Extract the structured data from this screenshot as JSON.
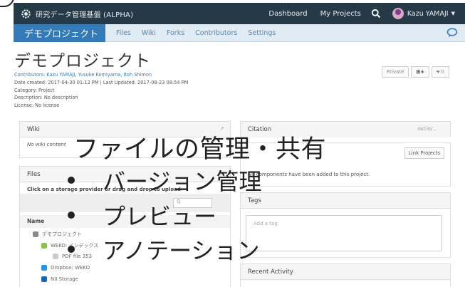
{
  "header": {
    "brand": "研究データ管理基盤 (ALPHA)",
    "nav": [
      "Dashboard",
      "My Projects"
    ],
    "user": "Kazu YAMAJI"
  },
  "project_bar": {
    "title": "デモプロジェクト",
    "tabs": [
      "Files",
      "Wiki",
      "Forks",
      "Contributors",
      "Settings"
    ]
  },
  "page": {
    "title": "デモプロジェクト",
    "badges": {
      "privacy": "Private",
      "fork_count": "0"
    },
    "meta": {
      "contributors_label": "Contributors:",
      "contributors": "Kazu YAMAJI, Yusuke Komiyama, Itoh Shimon",
      "dates": "Date created: 2017-04-30 01:12 PM | Last Updated: 2017-08-23 08:54 PM",
      "category": "Category: Project",
      "description": "Description: No description",
      "license": "License: No license"
    }
  },
  "wiki": {
    "heading": "Wiki",
    "body": "No wiki content"
  },
  "files": {
    "heading": "Files",
    "hint": "Click on a storage provider or drag and drop to upload",
    "name_col": "Name",
    "tree": [
      "デモプロジェクト",
      "WEKO: インデックス",
      "PDF file 353",
      "Dropbox: WEKO",
      "NII Storage"
    ]
  },
  "right": {
    "citation": "Citation",
    "citation_url": "osf.io/...",
    "components_empty": "No components have been added to this project.",
    "link_projects": "Link Projects",
    "tags_heading": "Tags",
    "tags_placeholder": "Add a tag",
    "recent_activity": "Recent Activity"
  },
  "overlay": {
    "title": "ファイルの管理・共有",
    "bullets": [
      "バージョン管理",
      "プレビュー",
      "アノテーション"
    ]
  },
  "colors": {
    "topbar": "#263947",
    "accent": "#337ab7",
    "projbar": "#e0ebf3"
  }
}
